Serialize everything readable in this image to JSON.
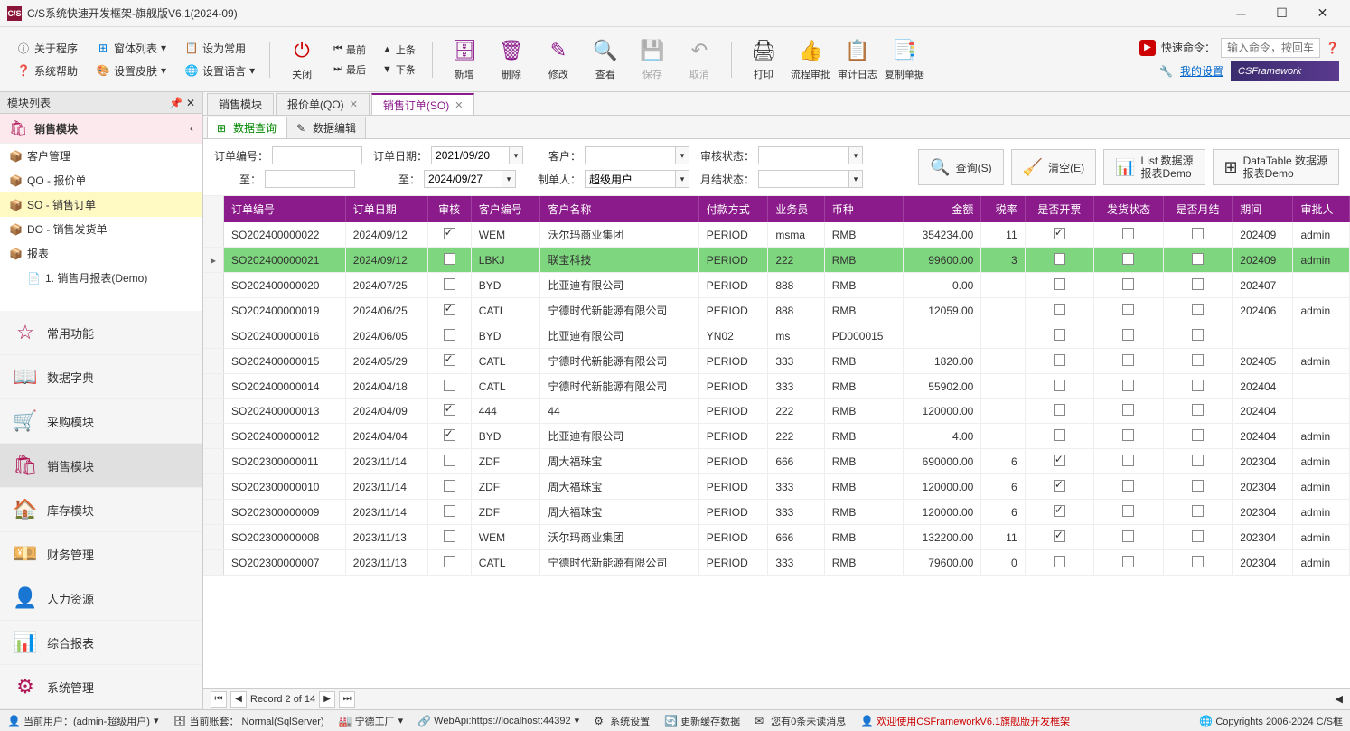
{
  "window": {
    "title": "C/S系统快速开发框架-旗舰版V6.1(2024-09)",
    "app_icon_text": "C/S"
  },
  "menubar": {
    "about": "关于程序",
    "forms": "窗体列表",
    "common": "设为常用",
    "help": "系统帮助",
    "skin": "设置皮肤",
    "lang": "设置语言"
  },
  "toolbar": {
    "close": "关闭",
    "first": "最前",
    "last": "最后",
    "prev": "上条",
    "next": "下条",
    "add": "新增",
    "delete": "删除",
    "edit": "修改",
    "view": "查看",
    "save": "保存",
    "cancel": "取消",
    "print": "打印",
    "approve": "流程审批",
    "auditlog": "审计日志",
    "copydoc": "复制单据",
    "quick_cmd_label": "快速命令：",
    "quick_cmd_placeholder": "输入命令，按回车",
    "my_settings": "我的设置",
    "cs_logo": "CSFramework"
  },
  "sidebar": {
    "header": "模块列表",
    "main_group": "销售模块",
    "tree_items": [
      {
        "icon": "📦",
        "label": "客户管理"
      },
      {
        "icon": "📦",
        "label": "QO - 报价单"
      },
      {
        "icon": "📦",
        "label": "SO - 销售订单",
        "selected": true
      },
      {
        "icon": "📦",
        "label": "DO - 销售发货单"
      },
      {
        "icon": "📦",
        "label": "报表"
      },
      {
        "icon": "📄",
        "label": "1. 销售月报表(Demo)",
        "indent": true
      }
    ],
    "modules": [
      {
        "icon": "☆",
        "label": "常用功能"
      },
      {
        "icon": "📖",
        "label": "数据字典"
      },
      {
        "icon": "🛒",
        "label": "采购模块"
      },
      {
        "icon": "🛍",
        "label": "销售模块",
        "active": true
      },
      {
        "icon": "🏠",
        "label": "库存模块"
      },
      {
        "icon": "💴",
        "label": "财务管理"
      },
      {
        "icon": "👤",
        "label": "人力资源"
      },
      {
        "icon": "📊",
        "label": "综合报表"
      },
      {
        "icon": "⚙",
        "label": "系统管理"
      }
    ]
  },
  "tabs": [
    {
      "label": "销售模块"
    },
    {
      "label": "报价单(QO)",
      "closable": true
    },
    {
      "label": "销售订单(SO)",
      "closable": true,
      "active": true
    }
  ],
  "subtabs": [
    {
      "icon": "⊞",
      "label": "数据查询",
      "active": true
    },
    {
      "icon": "✎",
      "label": "数据编辑"
    }
  ],
  "filters": {
    "labels": {
      "orderno": "订单编号：",
      "to": "至：",
      "orderdate": "订单日期：",
      "to2": "至：",
      "customer": "客户：",
      "creator": "制单人：",
      "auditstatus": "审核状态：",
      "monthstatus": "月结状态："
    },
    "values": {
      "date_from": "2021/09/20",
      "date_to": "2024/09/27",
      "creator": "超级用户"
    },
    "buttons": {
      "query": "查询(S)",
      "clear": "清空(E)",
      "list_demo_1": "List 数据源",
      "list_demo_2": "报表Demo",
      "dt_demo_1": "DataTable 数据源",
      "dt_demo_2": "报表Demo"
    }
  },
  "grid": {
    "columns": [
      "订单编号",
      "订单日期",
      "审核",
      "客户编号",
      "客户名称",
      "付款方式",
      "业务员",
      "币种",
      "金额",
      "税率",
      "是否开票",
      "发货状态",
      "是否月结",
      "期间",
      "审批人"
    ],
    "rows": [
      {
        "no": "SO202400000022",
        "date": "2024/09/12",
        "audit": true,
        "custcode": "WEM",
        "custname": "沃尔玛商业集团",
        "pay": "PERIOD",
        "sales": "msma",
        "curr": "RMB",
        "amount": "354234.00",
        "tax": "11",
        "invoice": true,
        "ship": false,
        "month": false,
        "period": "202409",
        "approver": "admin"
      },
      {
        "no": "SO202400000021",
        "date": "2024/09/12",
        "audit": false,
        "custcode": "LBKJ",
        "custname": "联宝科技",
        "pay": "PERIOD",
        "sales": "222",
        "curr": "RMB",
        "amount": "99600.00",
        "tax": "3",
        "invoice": false,
        "ship": false,
        "month": false,
        "period": "202409",
        "approver": "admin",
        "selected": true
      },
      {
        "no": "SO202400000020",
        "date": "2024/07/25",
        "audit": false,
        "custcode": "BYD",
        "custname": "比亚迪有限公司",
        "pay": "PERIOD",
        "sales": "888",
        "curr": "RMB",
        "amount": "0.00",
        "tax": "",
        "invoice": false,
        "ship": false,
        "month": false,
        "period": "202407",
        "approver": ""
      },
      {
        "no": "SO202400000019",
        "date": "2024/06/25",
        "audit": true,
        "custcode": "CATL",
        "custname": "宁德时代新能源有限公司",
        "pay": "PERIOD",
        "sales": "888",
        "curr": "RMB",
        "amount": "12059.00",
        "tax": "",
        "invoice": false,
        "ship": false,
        "month": false,
        "period": "202406",
        "approver": "admin"
      },
      {
        "no": "SO202400000016",
        "date": "2024/06/05",
        "audit": false,
        "custcode": "BYD",
        "custname": "比亚迪有限公司",
        "pay": "YN02",
        "sales": "ms",
        "curr": "PD000015",
        "amount": "",
        "tax": "",
        "invoice": false,
        "ship": false,
        "month": false,
        "period": "",
        "approver": ""
      },
      {
        "no": "SO202400000015",
        "date": "2024/05/29",
        "audit": true,
        "custcode": "CATL",
        "custname": "宁德时代新能源有限公司",
        "pay": "PERIOD",
        "sales": "333",
        "curr": "RMB",
        "amount": "1820.00",
        "tax": "",
        "invoice": false,
        "ship": false,
        "month": false,
        "period": "202405",
        "approver": "admin"
      },
      {
        "no": "SO202400000014",
        "date": "2024/04/18",
        "audit": false,
        "custcode": "CATL",
        "custname": "宁德时代新能源有限公司",
        "pay": "PERIOD",
        "sales": "333",
        "curr": "RMB",
        "amount": "55902.00",
        "tax": "",
        "invoice": false,
        "ship": false,
        "month": false,
        "period": "202404",
        "approver": ""
      },
      {
        "no": "SO202400000013",
        "date": "2024/04/09",
        "audit": true,
        "custcode": "444",
        "custname": "44",
        "pay": "PERIOD",
        "sales": "222",
        "curr": "RMB",
        "amount": "120000.00",
        "tax": "",
        "invoice": false,
        "ship": false,
        "month": false,
        "period": "202404",
        "approver": ""
      },
      {
        "no": "SO202400000012",
        "date": "2024/04/04",
        "audit": true,
        "custcode": "BYD",
        "custname": "比亚迪有限公司",
        "pay": "PERIOD",
        "sales": "222",
        "curr": "RMB",
        "amount": "4.00",
        "tax": "",
        "invoice": false,
        "ship": false,
        "month": false,
        "period": "202404",
        "approver": "admin"
      },
      {
        "no": "SO202300000011",
        "date": "2023/11/14",
        "audit": false,
        "custcode": "ZDF",
        "custname": "周大福珠宝",
        "pay": "PERIOD",
        "sales": "666",
        "curr": "RMB",
        "amount": "690000.00",
        "tax": "6",
        "invoice": true,
        "ship": false,
        "month": false,
        "period": "202304",
        "approver": "admin"
      },
      {
        "no": "SO202300000010",
        "date": "2023/11/14",
        "audit": false,
        "custcode": "ZDF",
        "custname": "周大福珠宝",
        "pay": "PERIOD",
        "sales": "333",
        "curr": "RMB",
        "amount": "120000.00",
        "tax": "6",
        "invoice": true,
        "ship": false,
        "month": false,
        "period": "202304",
        "approver": "admin"
      },
      {
        "no": "SO202300000009",
        "date": "2023/11/14",
        "audit": false,
        "custcode": "ZDF",
        "custname": "周大福珠宝",
        "pay": "PERIOD",
        "sales": "333",
        "curr": "RMB",
        "amount": "120000.00",
        "tax": "6",
        "invoice": true,
        "ship": false,
        "month": false,
        "period": "202304",
        "approver": "admin"
      },
      {
        "no": "SO202300000008",
        "date": "2023/11/13",
        "audit": false,
        "custcode": "WEM",
        "custname": "沃尔玛商业集团",
        "pay": "PERIOD",
        "sales": "666",
        "curr": "RMB",
        "amount": "132200.00",
        "tax": "11",
        "invoice": true,
        "ship": false,
        "month": false,
        "period": "202304",
        "approver": "admin"
      },
      {
        "no": "SO202300000007",
        "date": "2023/11/13",
        "audit": false,
        "custcode": "CATL",
        "custname": "宁德时代新能源有限公司",
        "pay": "PERIOD",
        "sales": "333",
        "curr": "RMB",
        "amount": "79600.00",
        "tax": "0",
        "invoice": false,
        "ship": false,
        "month": false,
        "period": "202304",
        "approver": "admin"
      }
    ],
    "footer_record": "Record 2 of 14"
  },
  "statusbar": {
    "user": "当前用户：(admin-超级用户)",
    "account": "当前账套： Normal(SqlServer)",
    "factory": "宁德工厂",
    "webapi": "WebApi:https://localhost:44392",
    "syssettings": "系统设置",
    "refreshcache": "更新缓存数据",
    "messages": "您有0条未读消息",
    "welcome": "欢迎使用CSFrameworkV6.1旗舰版开发框架",
    "copyright": "Copyrights 2006-2024 C/S框"
  }
}
